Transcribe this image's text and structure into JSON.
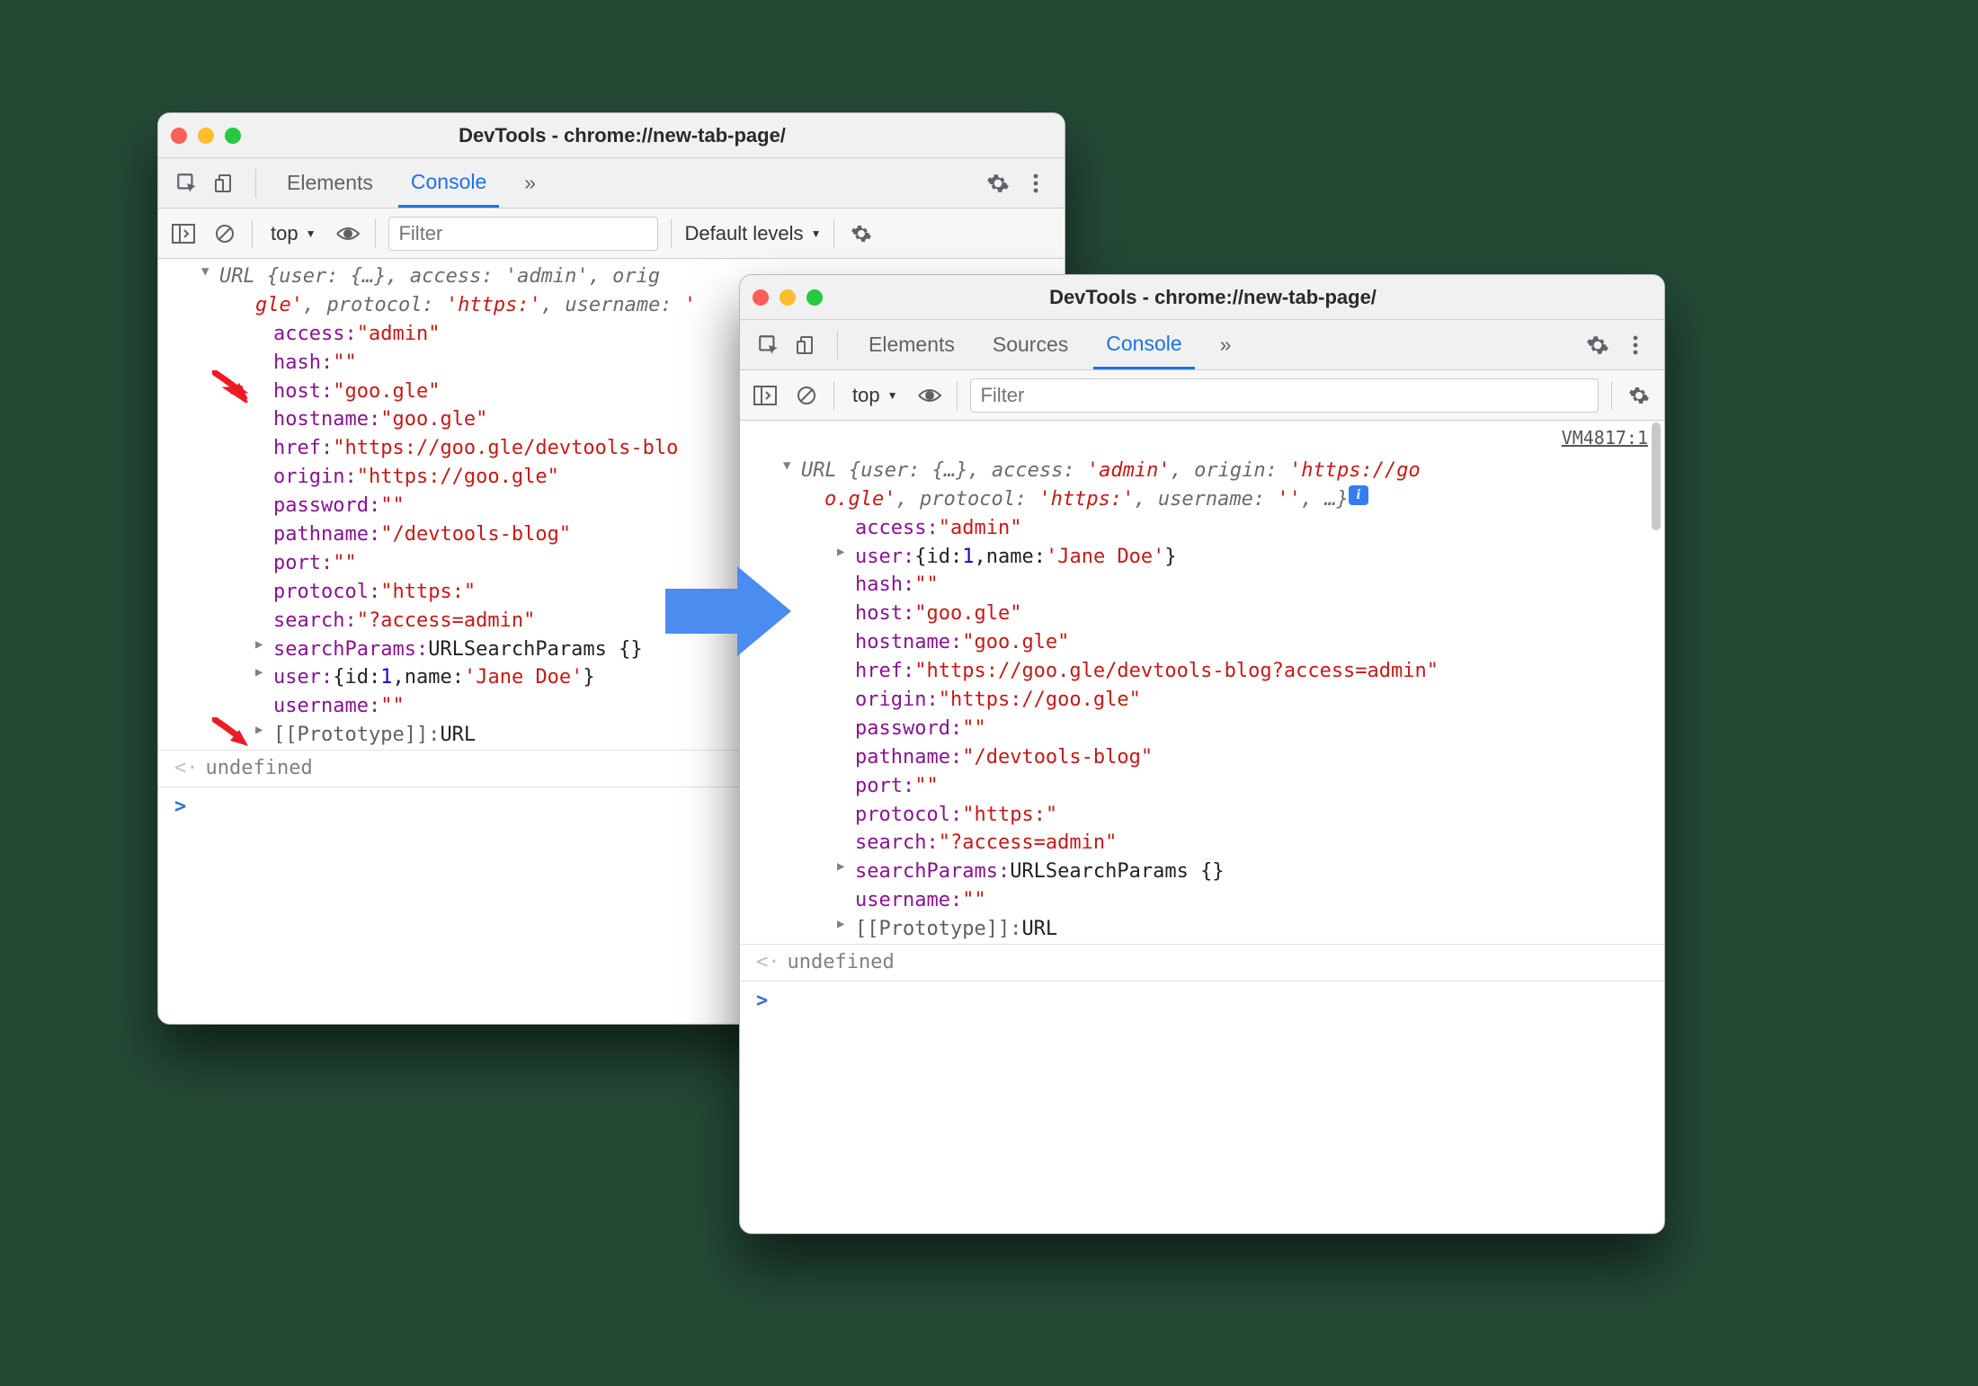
{
  "win1": {
    "title": "DevTools - chrome://new-tab-page/",
    "tabs": {
      "elements": "Elements",
      "console": "Console"
    },
    "ctx": "top",
    "filter_ph": "Filter",
    "levels": "Default levels",
    "summary1": "URL {user: {…}, access: 'admin', orig",
    "summary2a": "gle'",
    "summary2b": ", protocol: ",
    "summary2c": "'https:'",
    "summary2d": ", username: ",
    "summary2e": "'",
    "p": {
      "access_k": "access: ",
      "access_v": "\"admin\"",
      "hash_k": "hash: ",
      "hash_v": "\"\"",
      "host_k": "host: ",
      "host_v": "\"goo.gle\"",
      "hostname_k": "hostname: ",
      "hostname_v": "\"goo.gle\"",
      "href_k": "href: ",
      "href_v": "\"https://goo.gle/devtools-blo",
      "origin_k": "origin: ",
      "origin_v": "\"https://goo.gle\"",
      "password_k": "password: ",
      "password_v": "\"\"",
      "pathname_k": "pathname: ",
      "pathname_v": "\"/devtools-blog\"",
      "port_k": "port: ",
      "port_v": "\"\"",
      "protocol_k": "protocol: ",
      "protocol_v": "\"https:\"",
      "search_k": "search: ",
      "search_v": "\"?access=admin\"",
      "sp_k": "searchParams: ",
      "sp_v": "URLSearchParams {}",
      "user_k": "user: ",
      "user_v_open": "{",
      "user_id_k": "id: ",
      "user_id_v": "1",
      "user_sep": ", ",
      "user_name_k": "name: ",
      "user_name_v": "'Jane Doe'",
      "user_v_close": "}",
      "username_k": "username: ",
      "username_v": "\"\"",
      "proto_k": "[[Prototype]]: ",
      "proto_v": "URL"
    },
    "undef": "undefined"
  },
  "win2": {
    "title": "DevTools - chrome://new-tab-page/",
    "tabs": {
      "elements": "Elements",
      "sources": "Sources",
      "console": "Console"
    },
    "ctx": "top",
    "filter_ph": "Filter",
    "src": "VM4817:1",
    "sum_l1a": "URL {user: {…}, access: ",
    "sum_l1b": "'admin'",
    "sum_l1c": ", origin: ",
    "sum_l1d": "'https://go",
    "sum_l2a": "o.gle'",
    "sum_l2b": ", protocol: ",
    "sum_l2c": "'https:'",
    "sum_l2d": ", username: ",
    "sum_l2e": "''",
    "sum_l2f": ", …}",
    "p": {
      "access_k": "access: ",
      "access_v": "\"admin\"",
      "user_k": "user: ",
      "user_v_open": "{",
      "user_id_k": "id: ",
      "user_id_v": "1",
      "user_sep": ", ",
      "user_name_k": "name: ",
      "user_name_v": "'Jane Doe'",
      "user_v_close": "}",
      "hash_k": "hash: ",
      "hash_v": "\"\"",
      "host_k": "host: ",
      "host_v": "\"goo.gle\"",
      "hostname_k": "hostname: ",
      "hostname_v": "\"goo.gle\"",
      "href_k": "href: ",
      "href_v": "\"https://goo.gle/devtools-blog?access=admin\"",
      "origin_k": "origin: ",
      "origin_v": "\"https://goo.gle\"",
      "password_k": "password: ",
      "password_v": "\"\"",
      "pathname_k": "pathname: ",
      "pathname_v": "\"/devtools-blog\"",
      "port_k": "port: ",
      "port_v": "\"\"",
      "protocol_k": "protocol: ",
      "protocol_v": "\"https:\"",
      "search_k": "search: ",
      "search_v": "\"?access=admin\"",
      "sp_k": "searchParams: ",
      "sp_v": "URLSearchParams {}",
      "username_k": "username: ",
      "username_v": "\"\"",
      "proto_k": "[[Prototype]]: ",
      "proto_v": "URL"
    },
    "undef": "undefined"
  }
}
